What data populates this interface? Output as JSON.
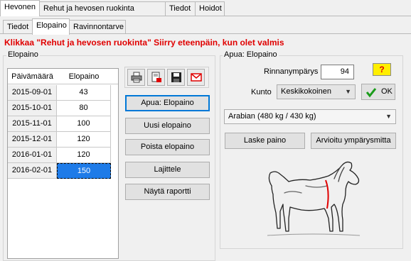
{
  "main_tabs": [
    "Hevonen",
    "Rehut ja hevosen ruokinta",
    "Tiedot",
    "Hoidot"
  ],
  "sub_tabs": [
    "Tiedot",
    "Elopaino",
    "Ravinnontarve"
  ],
  "notice": "Klikkaa \"Rehut ja hevosen ruokinta\" Siirry eteenpäin, kun olet valmis",
  "elopaino_group": {
    "title": "Elopaino",
    "table": {
      "headers": [
        "Päivämäärä",
        "Elopaino"
      ],
      "rows": [
        {
          "date": "2015-09-01",
          "value": "43"
        },
        {
          "date": "2015-10-01",
          "value": "80"
        },
        {
          "date": "2015-11-01",
          "value": "100"
        },
        {
          "date": "2015-12-01",
          "value": "120"
        },
        {
          "date": "2016-01-01",
          "value": "120"
        },
        {
          "date": "2016-02-01",
          "value": "150"
        }
      ]
    },
    "icons": [
      "print-icon",
      "export-icon",
      "save-icon",
      "email-icon"
    ],
    "buttons": {
      "help": "Apua: Elopaino",
      "new": "Uusi elopaino",
      "delete": "Poista elopaino",
      "sort": "Lajittele",
      "report": "Näytä raportti"
    }
  },
  "help_group": {
    "title": "Apua: Elopaino",
    "girth_label": "Rinnanympärys",
    "girth_value": "94",
    "condition_label": "Kunto",
    "condition_value": "Keskikokoinen",
    "question_label": "?",
    "ok_label": "OK",
    "breed_value": "Arabian   (480 kg / 430 kg)",
    "calc_button": "Laske paino",
    "estimate_button": "Arvioitu ympärysmitta"
  },
  "colors": {
    "notice": "#e00000",
    "selection": "#1e7be8",
    "question_bg": "#ffef00",
    "ok_check": "#1a9c1a",
    "girth_marker": "#e00000"
  }
}
